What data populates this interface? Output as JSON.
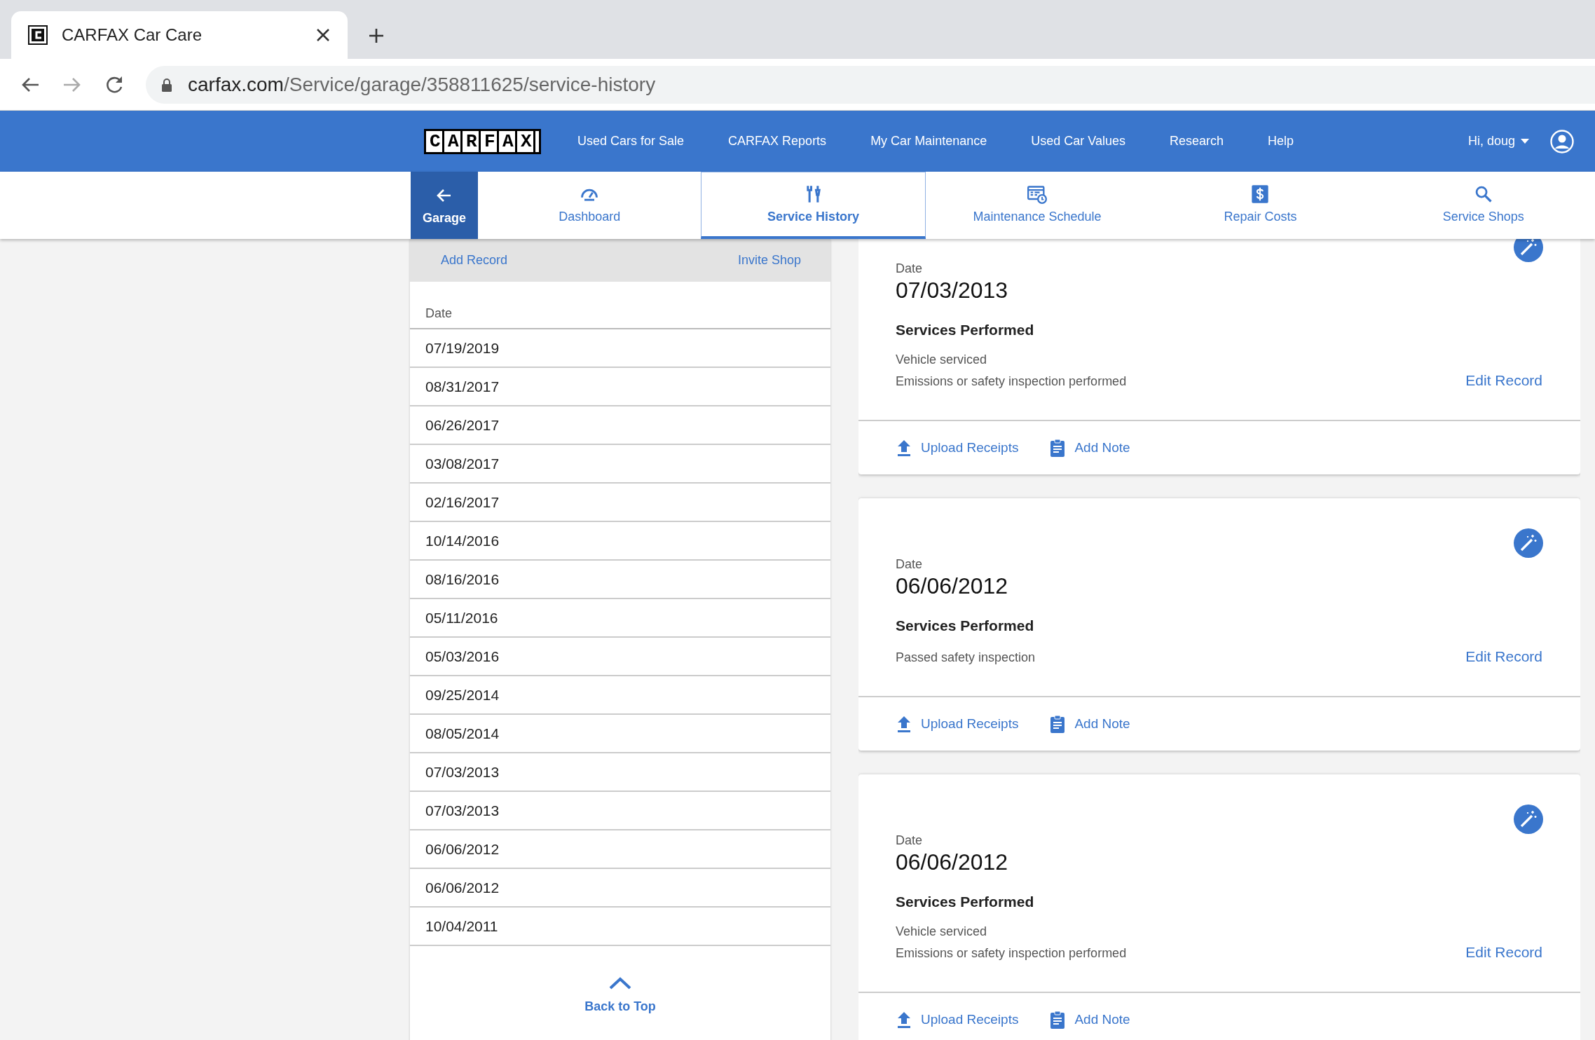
{
  "browser": {
    "tab_title": "CARFAX Car Care",
    "url_host": "carfax.com",
    "url_path": "/Service/garage/358811625/service-history"
  },
  "nav": {
    "logo": "CARFAX",
    "links": [
      "Used Cars for Sale",
      "CARFAX Reports",
      "My Car Maintenance",
      "Used Car Values",
      "Research",
      "Help"
    ],
    "user": "Hi, doug"
  },
  "subnav": {
    "back": "Garage",
    "tabs": [
      {
        "kind": "dashboard",
        "label": "Dashboard",
        "selected": false
      },
      {
        "kind": "history",
        "label": "Service History",
        "selected": true
      },
      {
        "kind": "schedule",
        "label": "Maintenance Schedule",
        "selected": false
      },
      {
        "kind": "costs",
        "label": "Repair Costs",
        "selected": false
      },
      {
        "kind": "shops",
        "label": "Service Shops",
        "selected": false
      }
    ]
  },
  "history": {
    "actions": [
      "Add Record",
      "Invite Shop"
    ],
    "column": "Date",
    "rows": [
      "07/19/2019",
      "08/31/2017",
      "06/26/2017",
      "03/08/2017",
      "02/16/2017",
      "10/14/2016",
      "08/16/2016",
      "05/11/2016",
      "05/03/2016",
      "09/25/2014",
      "08/05/2014",
      "07/03/2013",
      "07/03/2013",
      "06/06/2012",
      "06/06/2012",
      "10/04/2011"
    ],
    "back_to_top": "Back to Top"
  },
  "records": [
    {
      "date_label": "Date",
      "date": "07/03/2013",
      "section": "Services Performed",
      "services": [
        "Vehicle serviced",
        "Emissions or safety inspection performed"
      ],
      "edit": "Edit Record",
      "actions": [
        {
          "kind": "upload",
          "label": "Upload Receipts"
        },
        {
          "kind": "note",
          "label": "Add Note"
        }
      ]
    },
    {
      "date_label": "Date",
      "date": "06/06/2012",
      "section": "Services Performed",
      "services": [
        "Passed safety inspection"
      ],
      "edit": "Edit Record",
      "actions": [
        {
          "kind": "upload",
          "label": "Upload Receipts"
        },
        {
          "kind": "note",
          "label": "Add Note"
        }
      ]
    },
    {
      "date_label": "Date",
      "date": "06/06/2012",
      "section": "Services Performed",
      "services": [
        "Vehicle serviced",
        "Emissions or safety inspection performed"
      ],
      "edit": "Edit Record",
      "actions": [
        {
          "kind": "upload",
          "label": "Upload Receipts"
        },
        {
          "kind": "note",
          "label": "Add Note"
        }
      ]
    }
  ]
}
